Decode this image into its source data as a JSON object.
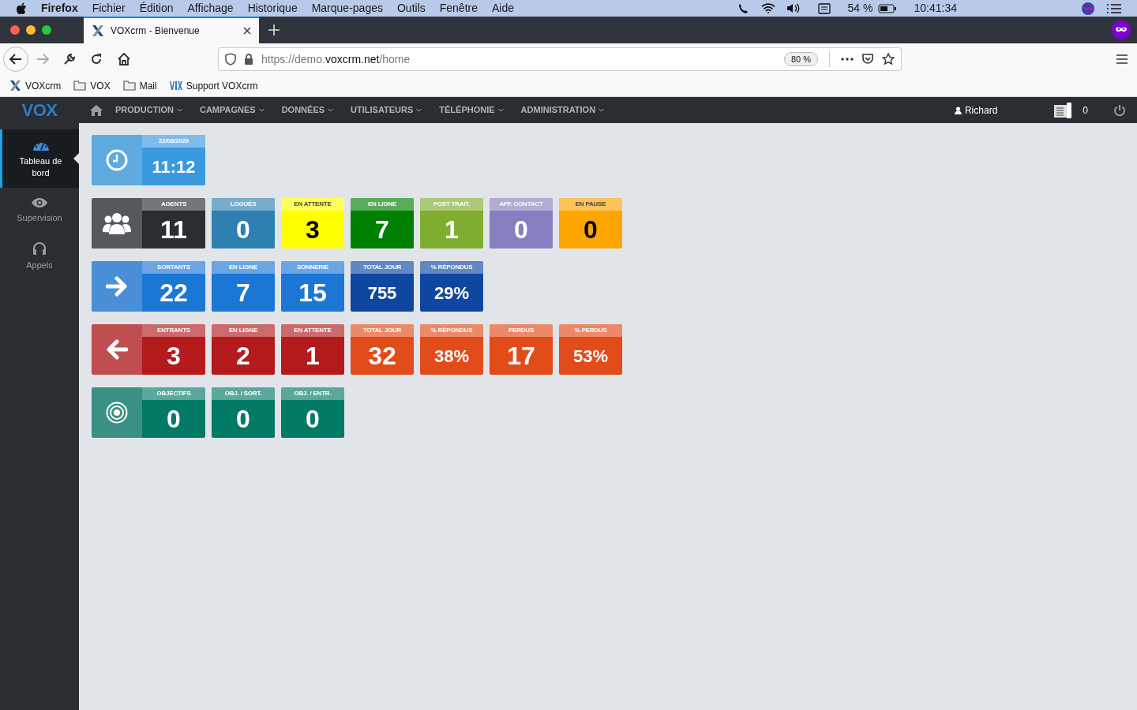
{
  "menubar": {
    "app": "Firefox",
    "items": [
      "Fichier",
      "Édition",
      "Affichage",
      "Historique",
      "Marque-pages",
      "Outils",
      "Fenêtre",
      "Aide"
    ],
    "battery": "54 %",
    "clock": "10:41:34"
  },
  "browser": {
    "tab_title": "VOXcrm - Bienvenue",
    "url_host": "https://demo.",
    "url_domain": "voxcrm.net",
    "url_path": "/home",
    "zoom": "80 %",
    "bookmarks": [
      {
        "kind": "logo",
        "label": "VOXcrm"
      },
      {
        "kind": "folder",
        "label": "VOX"
      },
      {
        "kind": "folder",
        "label": "Mail"
      },
      {
        "kind": "vox",
        "label": "Support VOXcrm"
      }
    ]
  },
  "app": {
    "logo": "VOX",
    "nav": [
      "PRODUCTION",
      "CAMPAGNES",
      "DONNÉES",
      "UTILISATEURS",
      "TÉLÉPHONIE",
      "ADMINISTRATION"
    ],
    "user": "Richard",
    "phone_count": "0",
    "sidebar": [
      {
        "kind": "dashboard",
        "label": "Tableau de bord",
        "selected": true
      },
      {
        "kind": "eye",
        "label": "Supervision",
        "selected": false
      },
      {
        "kind": "headset",
        "label": "Appels",
        "selected": false
      }
    ]
  },
  "tiles": [
    {
      "kind": "clock",
      "color": "#5eaadf",
      "cells": [
        {
          "label": "22/08/2020",
          "value": "11:12",
          "color": "#3a9ae0"
        }
      ]
    },
    {
      "kind": "users",
      "color": "#55585d",
      "cells": [
        {
          "label": "AGENTS",
          "value": "11",
          "color": "#2a2d31"
        },
        {
          "label": "LOGUÉS",
          "value": "0",
          "color": "#2e80b0"
        },
        {
          "label": "EN ATTENTE",
          "value": "3",
          "color": "#ffff00"
        },
        {
          "label": "EN LIGNE",
          "value": "7",
          "color": "#008000"
        },
        {
          "label": "POST TRAIT.",
          "value": "1",
          "color": "#7fad2f"
        },
        {
          "label": "AFF. CONTACT",
          "value": "0",
          "color": "#8480c0"
        },
        {
          "label": "EN PAUSE",
          "value": "0",
          "color": "#ffa500"
        }
      ]
    },
    {
      "kind": "arrow-right",
      "color": "#4a8fd8",
      "cells": [
        {
          "label": "SORTANTS",
          "value": "22",
          "color": "#1c76d4"
        },
        {
          "label": "EN LIGNE",
          "value": "7",
          "color": "#1c76d4"
        },
        {
          "label": "SONNERIE",
          "value": "15",
          "color": "#1c76d4"
        },
        {
          "label": "TOTAL JOUR",
          "value": "755",
          "color": "#0f47a0"
        },
        {
          "label": "% RÉPONDUS",
          "value": "29%",
          "color": "#0f47a0"
        }
      ]
    },
    {
      "kind": "arrow-left",
      "color": "#c04e50",
      "cells": [
        {
          "label": "ENTRANTS",
          "value": "3",
          "color": "#b31b1d"
        },
        {
          "label": "EN LIGNE",
          "value": "2",
          "color": "#b31b1d"
        },
        {
          "label": "EN ATTENTE",
          "value": "1",
          "color": "#b31b1d"
        },
        {
          "label": "TOTAL JOUR",
          "value": "32",
          "color": "#e24b1a"
        },
        {
          "label": "% RÉPONDUS",
          "value": "38%",
          "color": "#e24b1a"
        },
        {
          "label": "PERDUS",
          "value": "17",
          "color": "#e24b1a"
        },
        {
          "label": "% PERDUS",
          "value": "53%",
          "color": "#e24b1a"
        }
      ]
    },
    {
      "kind": "target",
      "color": "#3a9183",
      "cells": [
        {
          "label": "OBJECTIFS",
          "value": "0",
          "color": "#027a66"
        },
        {
          "label": "OBJ. / SORT.",
          "value": "0",
          "color": "#027a66"
        },
        {
          "label": "OBJ. / ENTR.",
          "value": "0",
          "color": "#027a66"
        }
      ]
    }
  ]
}
